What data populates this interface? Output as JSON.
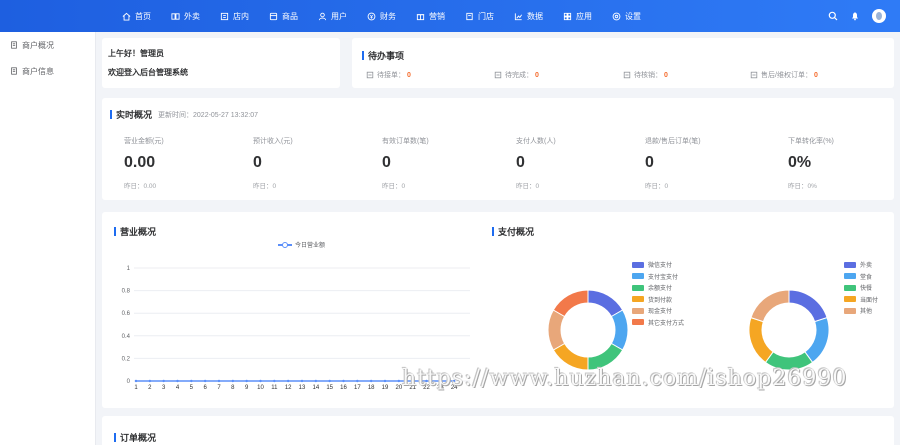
{
  "nav": {
    "items": [
      {
        "label": "首页",
        "icon": "home-icon"
      },
      {
        "label": "外卖",
        "icon": "takeout-icon"
      },
      {
        "label": "店内",
        "icon": "store-icon"
      },
      {
        "label": "商品",
        "icon": "goods-icon"
      },
      {
        "label": "用户",
        "icon": "user-icon"
      },
      {
        "label": "财务",
        "icon": "finance-icon"
      },
      {
        "label": "营销",
        "icon": "marketing-icon"
      },
      {
        "label": "门店",
        "icon": "shop-icon"
      },
      {
        "label": "数据",
        "icon": "data-icon"
      },
      {
        "label": "应用",
        "icon": "apps-icon"
      },
      {
        "label": "设置",
        "icon": "settings-icon"
      }
    ]
  },
  "sidebar": {
    "items": [
      {
        "label": "商户概况"
      },
      {
        "label": "商户信息"
      }
    ]
  },
  "greeting": {
    "line1": "上午好！管理员",
    "line2": "欢迎登入后台管理系统"
  },
  "todo": {
    "title": "待办事项",
    "items": [
      {
        "label": "待接单：",
        "count": "0"
      },
      {
        "label": "待完成：",
        "count": "0"
      },
      {
        "label": "待核销：",
        "count": "0"
      },
      {
        "label": "售后/维权订单：",
        "count": "0"
      }
    ]
  },
  "realtime": {
    "title": "实时概况",
    "time": "更新时间：2022-05-27 13:32:07",
    "stats": [
      {
        "label": "营业金额(元)",
        "value": "0.00",
        "sub": "昨日：0.00"
      },
      {
        "label": "预计收入(元)",
        "value": "0",
        "sub": "昨日：0"
      },
      {
        "label": "有效订单数(笔)",
        "value": "0",
        "sub": "昨日：0"
      },
      {
        "label": "支付人数(人)",
        "value": "0",
        "sub": "昨日：0"
      },
      {
        "label": "退款/售后订单(笔)",
        "value": "0",
        "sub": "昨日：0"
      },
      {
        "label": "下单转化率(%)",
        "value": "0%",
        "sub": "昨日：0%"
      }
    ]
  },
  "business": {
    "title": "营业概况",
    "pay_title": "支付概况",
    "pay_legend": [
      {
        "label": "微信支付",
        "color": "#5b6ee1"
      },
      {
        "label": "支付宝支付",
        "color": "#4da6f0"
      },
      {
        "label": "余额支付",
        "color": "#3fc47b"
      },
      {
        "label": "货到付款",
        "color": "#f5a623"
      },
      {
        "label": "现金支付",
        "color": "#e8a77a"
      },
      {
        "label": "其它支付方式",
        "color": "#f2794a"
      }
    ],
    "type_legend": [
      {
        "label": "外卖",
        "color": "#5b6ee1"
      },
      {
        "label": "堂食",
        "color": "#4da6f0"
      },
      {
        "label": "快餐",
        "color": "#3fc47b"
      },
      {
        "label": "当面付",
        "color": "#f5a623"
      },
      {
        "label": "其他",
        "color": "#e8a77a"
      }
    ]
  },
  "chart_data": [
    {
      "type": "line",
      "title": "",
      "series": [
        {
          "name": "今日营业额",
          "values": [
            0,
            0,
            0,
            0,
            0,
            0,
            0,
            0,
            0,
            0,
            0,
            0,
            0,
            0,
            0,
            0,
            0,
            0,
            0,
            0,
            0,
            0,
            0,
            0
          ]
        }
      ],
      "x": [
        1,
        2,
        3,
        4,
        5,
        6,
        7,
        8,
        9,
        10,
        11,
        12,
        13,
        14,
        15,
        16,
        17,
        18,
        19,
        20,
        21,
        22,
        23,
        24
      ],
      "ylim": [
        0,
        1
      ],
      "yticks": [
        0,
        0.2,
        0.4,
        0.6,
        0.8,
        1
      ],
      "color": "#5b8ff9"
    },
    {
      "type": "pie",
      "labels": [
        "微信支付",
        "支付宝支付",
        "余额支付",
        "货到付款",
        "现金支付",
        "其它支付方式"
      ],
      "values": [
        1,
        1,
        1,
        1,
        1,
        1
      ],
      "colors": [
        "#5b6ee1",
        "#4da6f0",
        "#3fc47b",
        "#f5a623",
        "#e8a77a",
        "#f2794a"
      ]
    },
    {
      "type": "pie",
      "labels": [
        "外卖",
        "堂食",
        "快餐",
        "当面付",
        "其他"
      ],
      "values": [
        1,
        1,
        1,
        1,
        1
      ],
      "colors": [
        "#5b6ee1",
        "#4da6f0",
        "#3fc47b",
        "#f5a623",
        "#e8a77a"
      ]
    }
  ],
  "watermark": "https://www.huzhan.com/ishop26990",
  "order": {
    "title": "订单概况"
  },
  "colors": {
    "primary": "#1e6cf0",
    "alert": "#f56c2d"
  }
}
